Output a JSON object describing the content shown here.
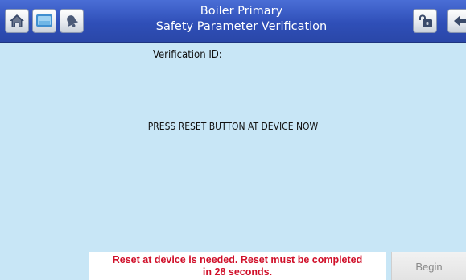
{
  "header": {
    "title_line1": "Boiler Primary",
    "title_line2": "Safety Parameter Verification",
    "left_buttons": [
      "home-icon",
      "screen-icon",
      "alarm-bell-icon"
    ],
    "right_buttons": [
      "lock-icon",
      "back-arrow-icon"
    ]
  },
  "main": {
    "verification_id_label": "Verification ID:",
    "instruction": "PRESS RESET BUTTON AT DEVICE NOW"
  },
  "footer": {
    "status_line1": "Reset at device is needed. Reset must be completed",
    "status_line2": "in 28 seconds.",
    "begin_label": "Begin"
  },
  "colors": {
    "background": "#c8e6f6",
    "titlebar": "#2f4fb8",
    "status_text": "#d0102a"
  }
}
